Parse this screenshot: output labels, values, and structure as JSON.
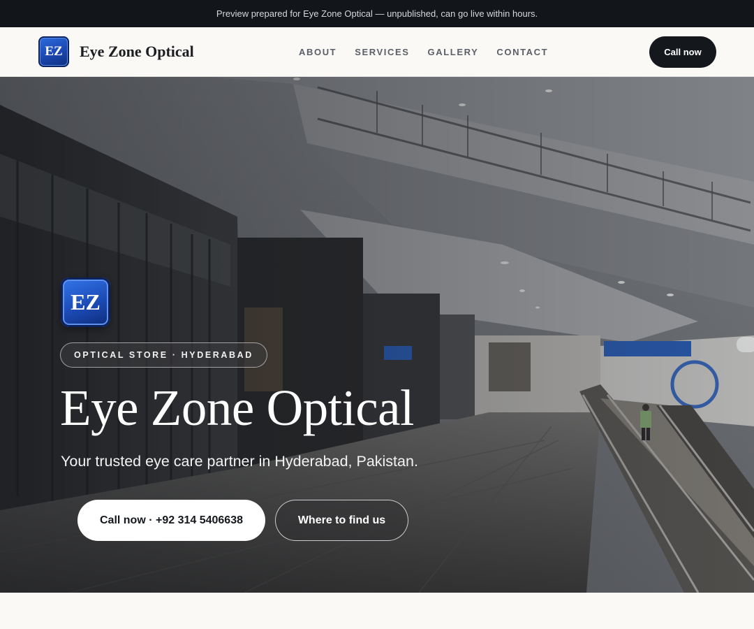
{
  "preview_bar": {
    "text": "Preview prepared for Eye Zone Optical — unpublished, can go live within hours."
  },
  "header": {
    "logo_text": "EZ",
    "brand_name": "Eye Zone Optical",
    "nav": [
      "ABOUT",
      "SERVICES",
      "GALLERY",
      "CONTACT"
    ],
    "cta_label": "Call now"
  },
  "hero": {
    "logo_text": "EZ",
    "tag": "OPTICAL STORE · HYDERABAD",
    "title": "Eye Zone Optical",
    "subtitle": "Your trusted eye care partner in Hyderabad, Pakistan.",
    "primary_button": "Call now · +92 314 5406638",
    "secondary_button": "Where to find us"
  },
  "colors": {
    "dark": "#14171c",
    "brand_blue": "#1a47b0",
    "page_bg": "#faf9f6"
  },
  "icons": {
    "background": "mall-interior-photo"
  }
}
